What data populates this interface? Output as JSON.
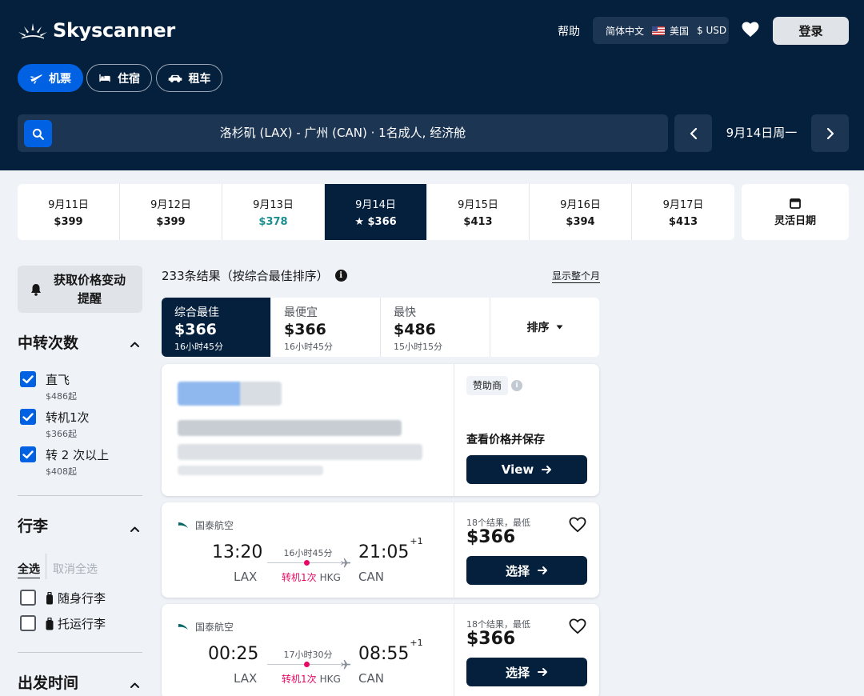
{
  "colors": {
    "header_bg": "#05203c",
    "accent": "#0062e3",
    "stop_pink": "#e70866",
    "green_price": "#1b8f8f"
  },
  "header": {
    "logo": "Skyscanner",
    "help": "帮助",
    "language": "简体中文",
    "region": "美国",
    "currency": "$ USD",
    "login": "登录",
    "tabs": [
      {
        "label": "机票",
        "icon": "plane-icon",
        "active": true
      },
      {
        "label": "住宿",
        "icon": "bed-icon",
        "active": false
      },
      {
        "label": "租车",
        "icon": "car-icon",
        "active": false
      }
    ],
    "search_summary": "洛杉矶 (LAX) - 广州 (CAN) · 1名成人, 经济舱",
    "current_date": "9月14日周一"
  },
  "dates": [
    {
      "date": "9月11日",
      "price": "$399"
    },
    {
      "date": "9月12日",
      "price": "$399"
    },
    {
      "date": "9月13日",
      "price": "$378"
    },
    {
      "date": "9月14日",
      "price": "★ $366"
    },
    {
      "date": "9月15日",
      "price": "$413"
    },
    {
      "date": "9月16日",
      "price": "$394"
    },
    {
      "date": "9月17日",
      "price": "$413"
    }
  ],
  "flex_date": "灵活日期",
  "sidebar": {
    "alert": "获取价格变动提醒",
    "stops_title": "中转次数",
    "stops": [
      {
        "label": "直飞",
        "sub": "$486起"
      },
      {
        "label": "转机1次",
        "sub": "$366起"
      },
      {
        "label": "转 2 次以上",
        "sub": "$408起"
      }
    ],
    "baggage_title": "行李",
    "select_all": "全选",
    "deselect_all": "取消全选",
    "bags": [
      {
        "label": "随身行李"
      },
      {
        "label": "托运行李"
      }
    ],
    "departure_title": "出发时间"
  },
  "results": {
    "count": "233条结果（按综合最佳排序）",
    "show_month": "显示整个月",
    "sort_tabs": [
      {
        "title": "综合最佳",
        "price": "$366",
        "duration": "16小时45分"
      },
      {
        "title": "最便宜",
        "price": "$366",
        "duration": "16小时45分"
      },
      {
        "title": "最快",
        "price": "$486",
        "duration": "15小时15分"
      }
    ],
    "sort_label": "排序"
  },
  "sponsored": {
    "tag": "赞助商",
    "info": "i",
    "message": "查看价格并保存",
    "button": "View"
  },
  "flights": [
    {
      "airline": "国泰航空",
      "dep_time": "13:20",
      "dep_airport": "LAX",
      "duration": "16小时45分",
      "stops": "转机1次",
      "via": "HKG",
      "arr_time": "21:05",
      "arr_offset": "+1",
      "arr_airport": "CAN",
      "deal_label": "18个结果，最低",
      "price": "$366",
      "button": "选择"
    },
    {
      "airline": "国泰航空",
      "dep_time": "00:25",
      "dep_airport": "LAX",
      "duration": "17小时30分",
      "stops": "转机1次",
      "via": "HKG",
      "arr_time": "08:55",
      "arr_offset": "+1",
      "arr_airport": "CAN",
      "deal_label": "18个结果，最低",
      "price": "$366",
      "button": "选择"
    }
  ]
}
